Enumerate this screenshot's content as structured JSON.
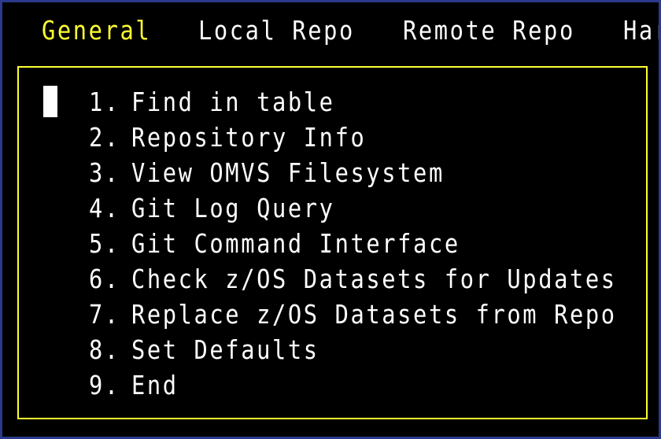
{
  "colors": {
    "background": "#000000",
    "window_border": "#2b3a8c",
    "active_tab": "#ffff33",
    "panel_border": "#ffff33",
    "text": "#ffffff"
  },
  "menubar": {
    "tabs": [
      {
        "label": "General",
        "active": true
      },
      {
        "label": "Local Repo",
        "active": false
      },
      {
        "label": "Remote Repo",
        "active": false
      },
      {
        "label": "Har",
        "active": false
      }
    ]
  },
  "menu": {
    "items": [
      {
        "number": "1.",
        "label": "Find in table"
      },
      {
        "number": "2.",
        "label": "Repository Info"
      },
      {
        "number": "3.",
        "label": "View OMVS Filesystem"
      },
      {
        "number": "4.",
        "label": "Git Log Query"
      },
      {
        "number": "5.",
        "label": "Git Command Interface"
      },
      {
        "number": "6.",
        "label": "Check z/OS Datasets for Updates"
      },
      {
        "number": "7.",
        "label": "Replace z/OS Datasets from Repo"
      },
      {
        "number": "8.",
        "label": "Set Defaults"
      },
      {
        "number": "9.",
        "label": "End"
      }
    ]
  }
}
